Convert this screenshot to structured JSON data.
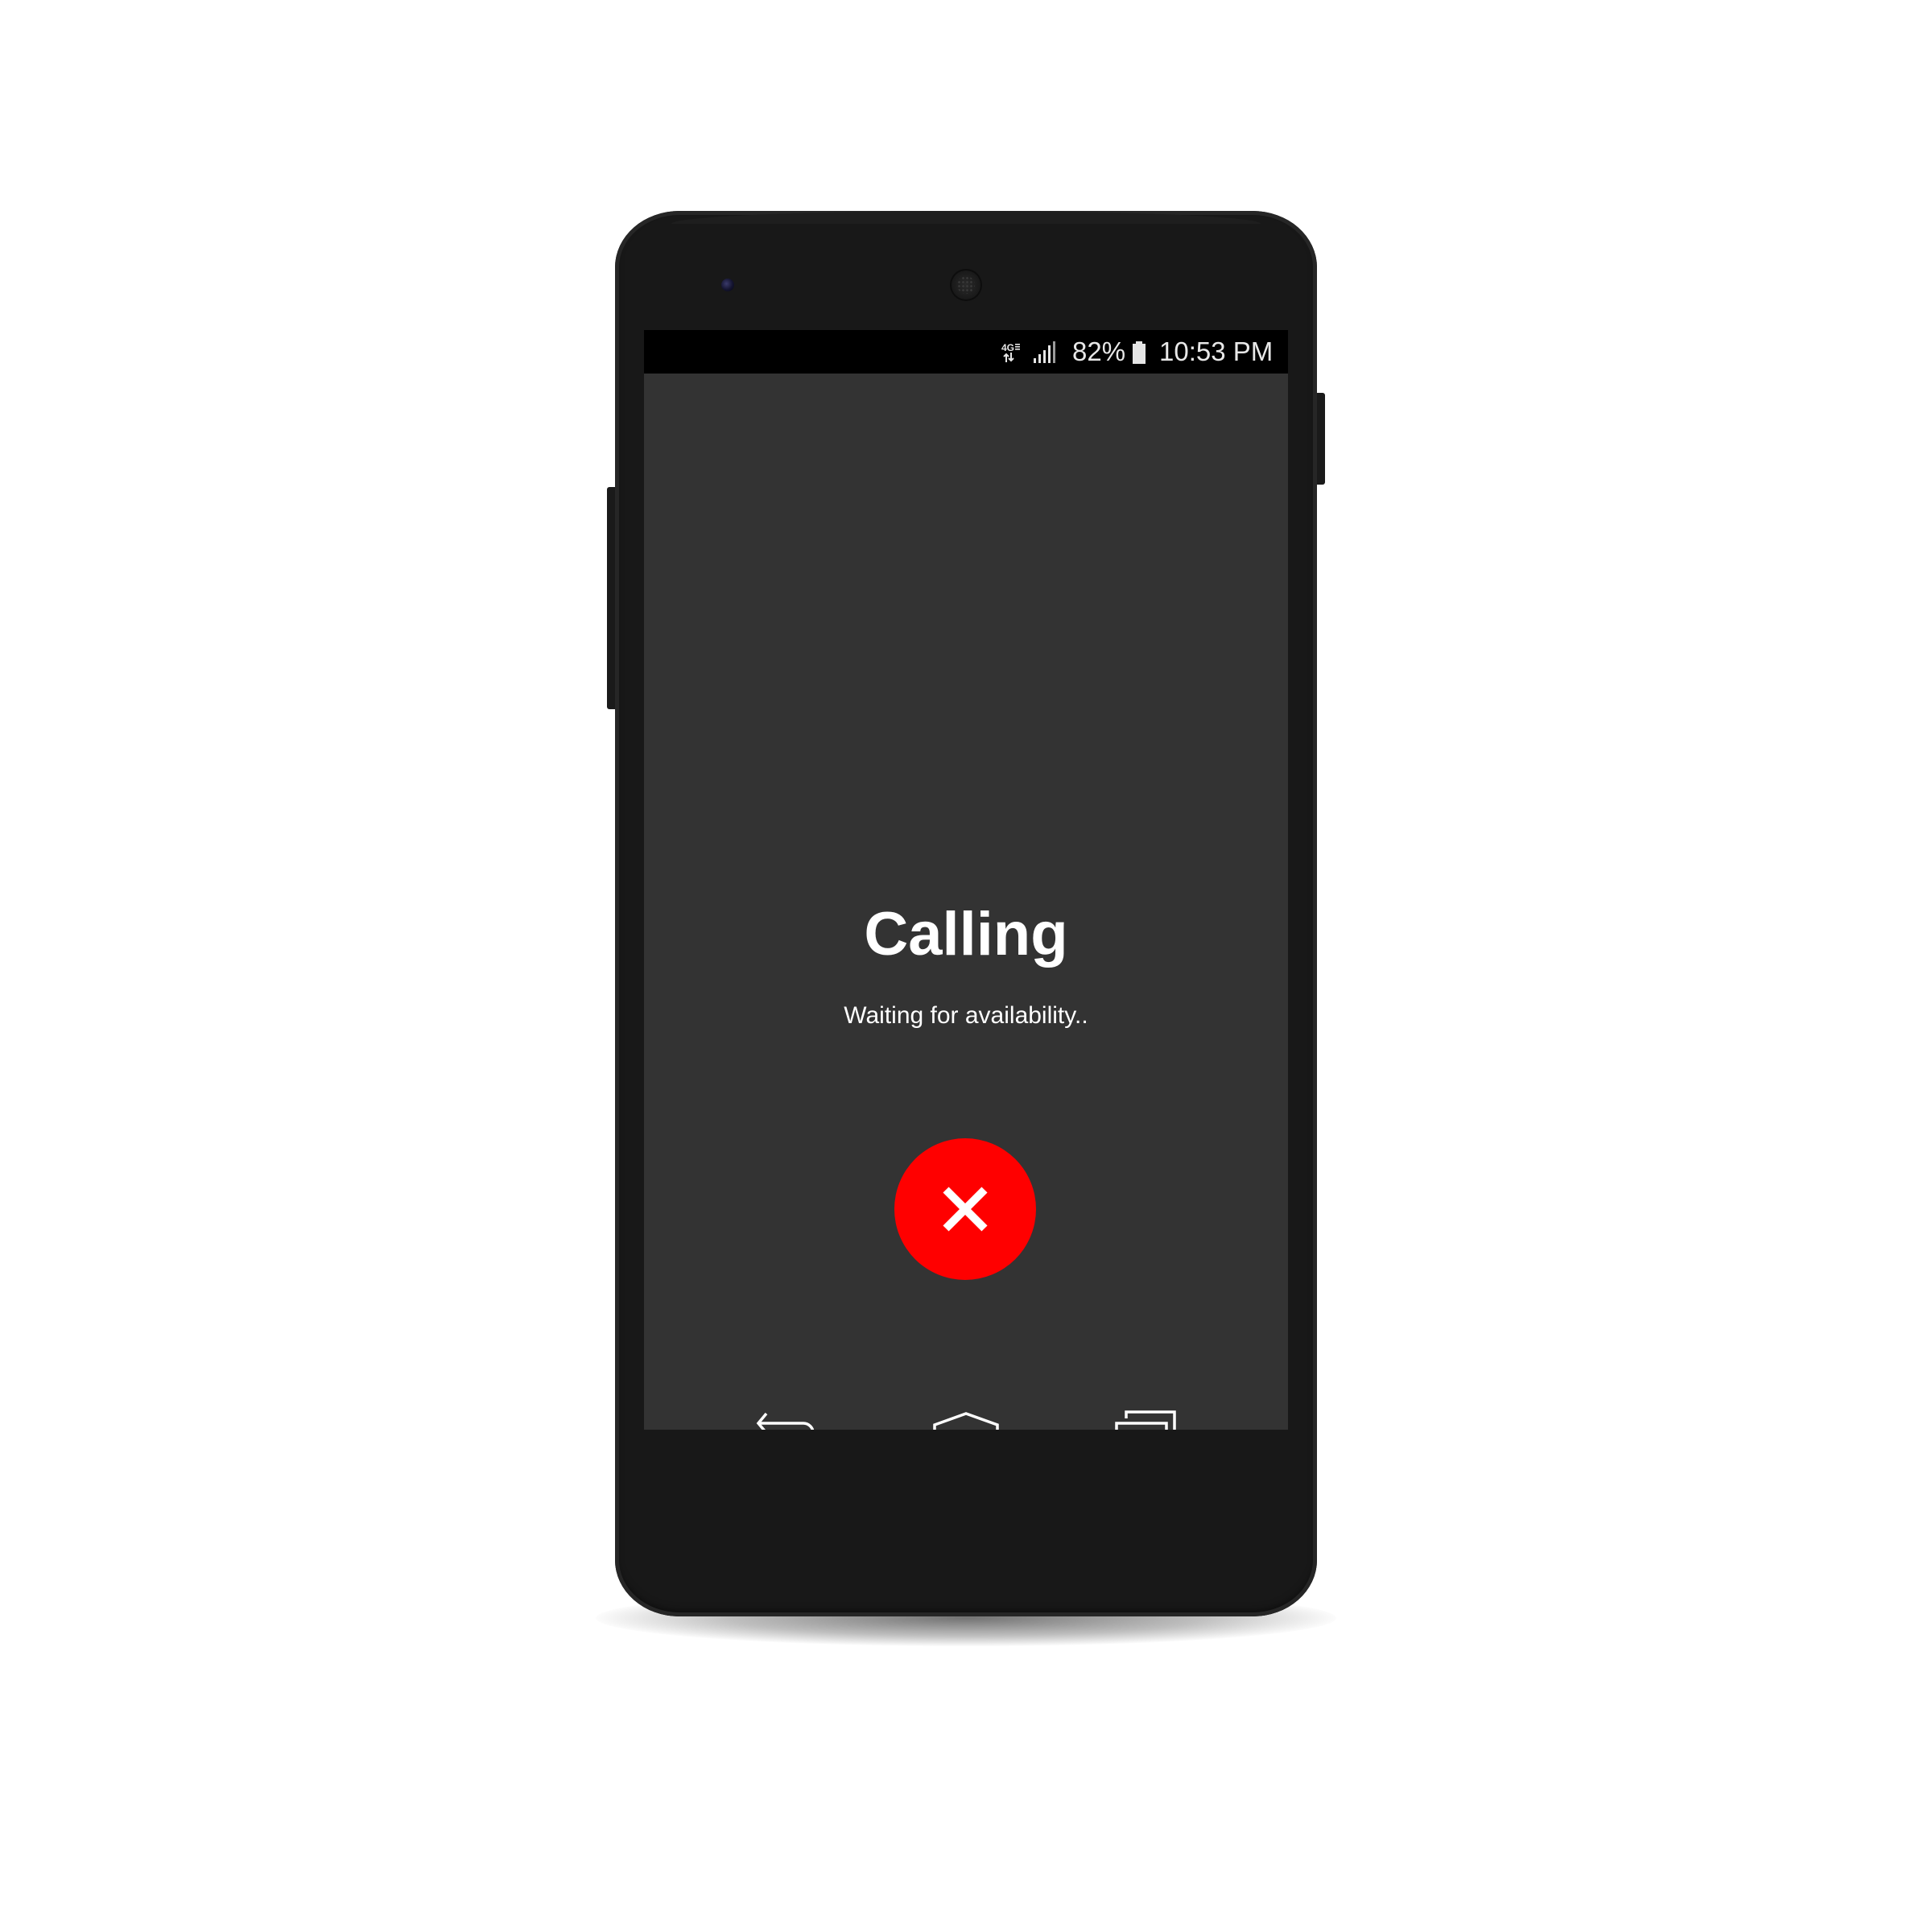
{
  "status_bar": {
    "network_icon": "4g-lte-icon",
    "signal_icon": "signal-strength-icon",
    "battery_percent": "82%",
    "battery_icon": "battery-icon",
    "time": "10:53 PM"
  },
  "call": {
    "title": "Calling",
    "subtitle": "Waiting for availability..",
    "end_button_icon": "close-icon",
    "end_button_color": "#ff0000"
  },
  "nav_bar": {
    "back_icon": "back-icon",
    "home_icon": "home-icon",
    "recent_apps_icon": "recent-apps-icon"
  },
  "colors": {
    "screen_background": "#333333",
    "status_bar_background": "#000000",
    "phone_body": "#181818"
  }
}
